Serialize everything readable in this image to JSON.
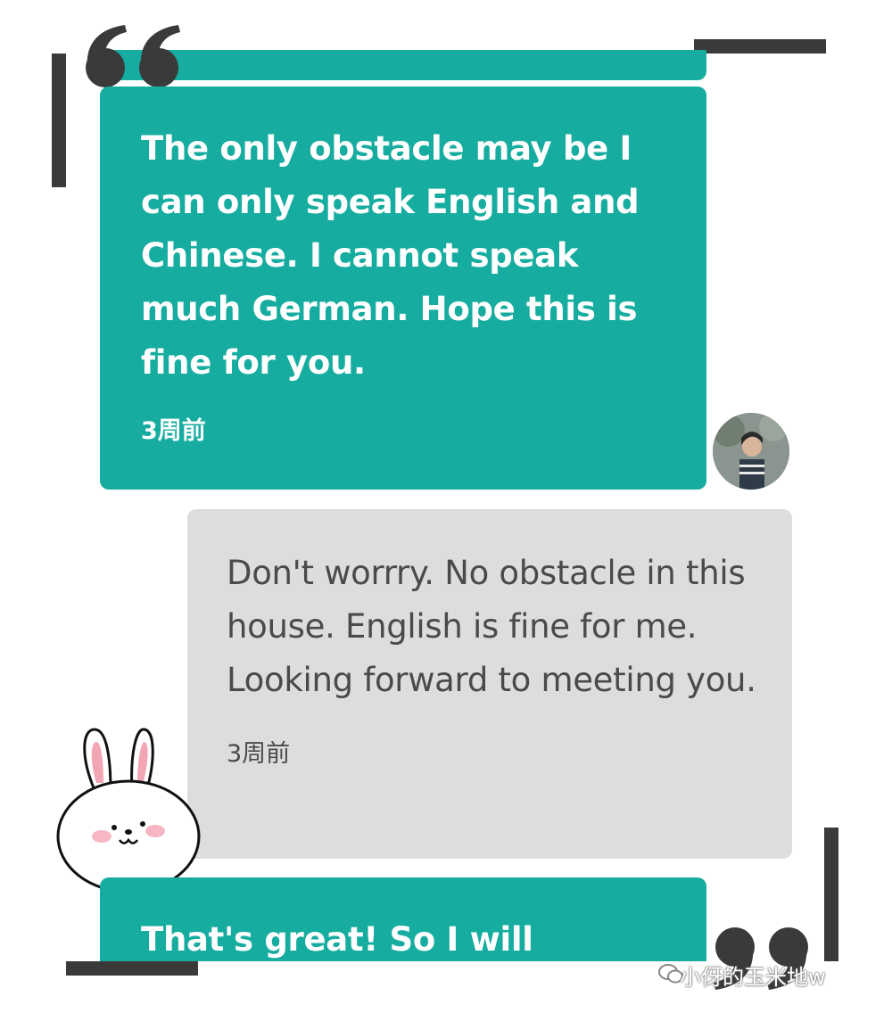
{
  "messages": [
    {
      "sender": "guest",
      "text": "The only obstacle may be I can only speak English and Chinese. I cannot speak much German. Hope this is fine for you.",
      "time": "3周前"
    },
    {
      "sender": "host",
      "text": "Don't worrry. No obstacle in this house. English is fine for me. Looking forward to meeting you.",
      "time": "3周前"
    },
    {
      "sender": "guest",
      "text": "That's great! So I will"
    }
  ],
  "watermark": "小伢的玉米地w",
  "colors": {
    "guest_bubble": "#16ada0",
    "host_bubble": "#dedcdf",
    "frame": "#3a3a3a"
  },
  "icons": [
    "open-quote-icon",
    "close-quote-icon",
    "bunny-sticker",
    "user-avatar",
    "wechat-logo-icon"
  ]
}
